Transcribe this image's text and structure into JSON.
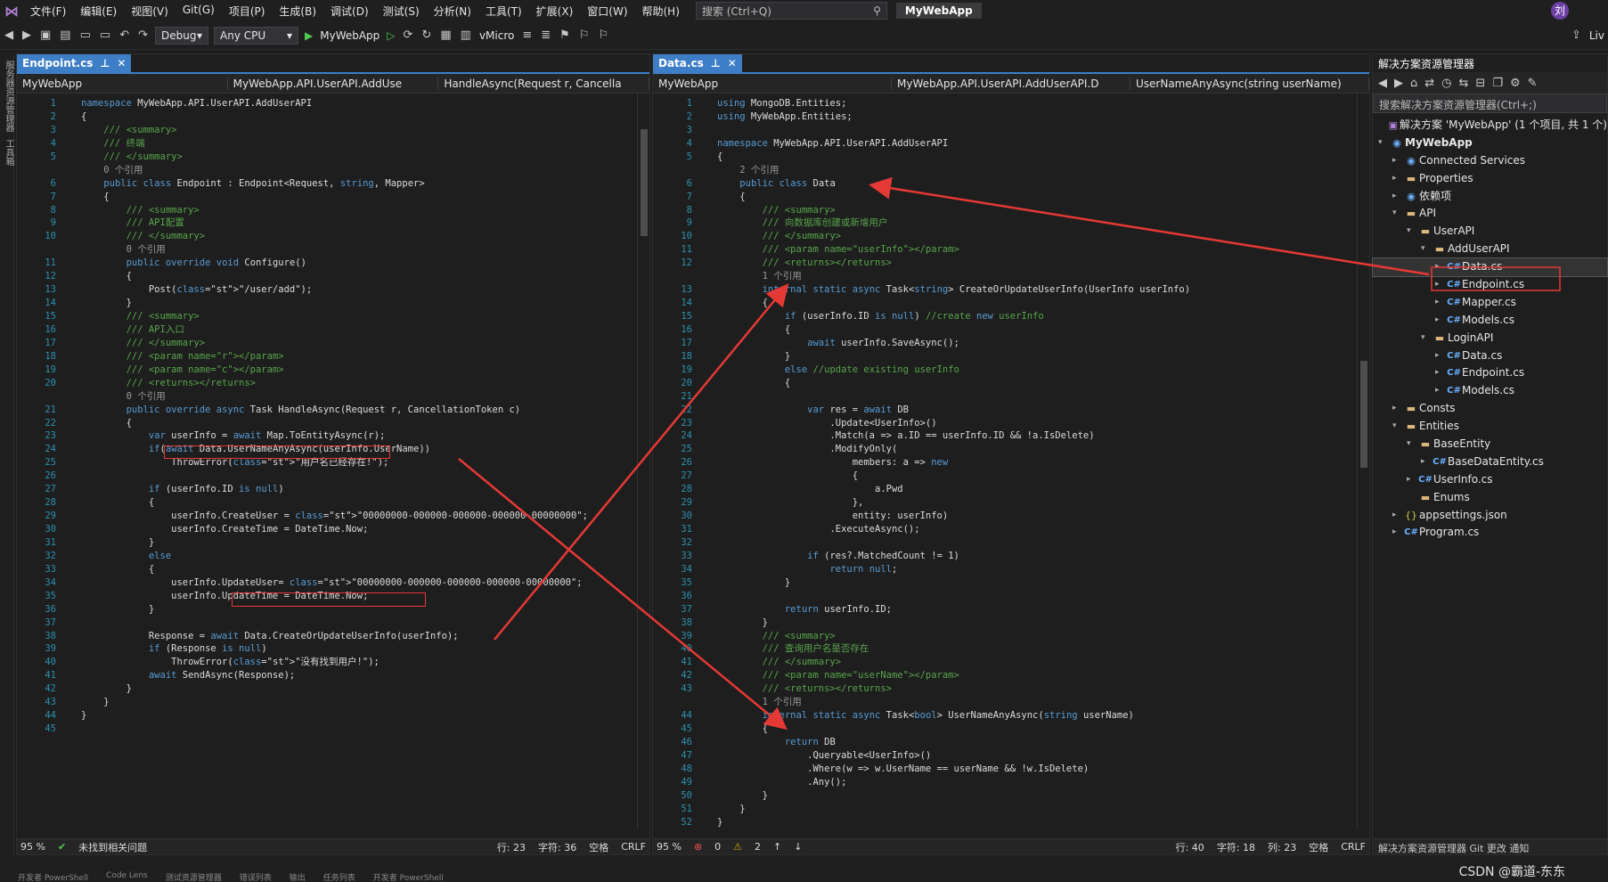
{
  "menubar": {
    "items": [
      "文件(F)",
      "编辑(E)",
      "视图(V)",
      "Git(G)",
      "项目(P)",
      "生成(B)",
      "调试(D)",
      "测试(S)",
      "分析(N)",
      "工具(T)",
      "扩展(X)",
      "窗口(W)",
      "帮助(H)"
    ],
    "search": "搜索 (Ctrl+Q)",
    "project": "MyWebApp",
    "avatar": "刘"
  },
  "toolbar": {
    "config": "Debug",
    "platform": "Any CPU",
    "run": "MyWebApp",
    "vmicro": "vMicro",
    "live": "Liv"
  },
  "leftstrip": {
    "a": "服务器资源管理器",
    "b": "工具箱"
  },
  "left": {
    "tab": "Endpoint.cs",
    "nav1": "MyWebApp",
    "nav2": "MyWebApp.API.UserAPI.AddUse",
    "nav3": "HandleAsync(Request r, Cancella",
    "lines": [
      "namespace MyWebApp.API.UserAPI.AddUserAPI",
      "{",
      "    /// <summary>",
      "    /// 终端",
      "    /// </summary>",
      "    0 个引用",
      "    public class Endpoint : Endpoint<Request, string, Mapper>",
      "    {",
      "        /// <summary>",
      "        /// API配置",
      "        /// </summary>",
      "        0 个引用",
      "        public override void Configure()",
      "        {",
      "            Post(\"/user/add\");",
      "        }",
      "        /// <summary>",
      "        /// API入口",
      "        /// </summary>",
      "        /// <param name=\"r\"></param>",
      "        /// <param name=\"c\"></param>",
      "        /// <returns></returns>",
      "        0 个引用",
      "        public override async Task HandleAsync(Request r, CancellationToken c)",
      "        {",
      "            var userInfo = await Map.ToEntityAsync(r);",
      "            if(await Data.UserNameAnyAsync(userInfo.UserName))",
      "                ThrowError(\"用户名已经存在!\");",
      "",
      "            if (userInfo.ID is null)",
      "            {",
      "                userInfo.CreateUser = \"00000000-000000-000000-000000-00000000\";",
      "                userInfo.CreateTime = DateTime.Now;",
      "            }",
      "            else",
      "            {",
      "                userInfo.UpdateUser= \"00000000-000000-000000-000000-00000000\";",
      "                userInfo.UpdateTime = DateTime.Now;",
      "            }",
      "",
      "            Response = await Data.CreateOrUpdateUserInfo(userInfo);",
      "            if (Response is null)",
      "                ThrowError(\"没有找到用户!\");",
      "            await SendAsync(Response);",
      "        }",
      "    }",
      "}",
      ""
    ],
    "nums": [
      "1",
      "2",
      "3",
      "4",
      "5",
      "",
      "6",
      "7",
      "8",
      "9",
      "10",
      "",
      "11",
      "12",
      "13",
      "14",
      "15",
      "16",
      "17",
      "18",
      "19",
      "20",
      "",
      "21",
      "22",
      "23",
      "24",
      "25",
      "26",
      "27",
      "28",
      "29",
      "30",
      "31",
      "32",
      "33",
      "34",
      "35",
      "36",
      "37",
      "38",
      "39",
      "40",
      "41",
      "42",
      "43",
      "44",
      "45"
    ],
    "status": {
      "zoom": "95 %",
      "issues": "未找到相关问题",
      "row": "行: 23",
      "col": "字符: 36",
      "space": "空格",
      "eol": "CRLF"
    }
  },
  "right": {
    "tab": "Data.cs",
    "nav1": "MyWebApp",
    "nav2": "MyWebApp.API.UserAPI.AddUserAPI.D",
    "nav3": "UserNameAnyAsync(string userName)",
    "lines": [
      "using MongoDB.Entities;",
      "using MyWebApp.Entities;",
      "",
      "namespace MyWebApp.API.UserAPI.AddUserAPI",
      "{",
      "    2 个引用",
      "    public class Data",
      "    {",
      "        /// <summary>",
      "        /// 向数据库创建或新增用户",
      "        /// </summary>",
      "        /// <param name=\"userInfo\"></param>",
      "        /// <returns></returns>",
      "        1 个引用",
      "        internal static async Task<string> CreateOrUpdateUserInfo(UserInfo userInfo)",
      "        {",
      "            if (userInfo.ID is null) //create new userInfo",
      "            {",
      "                await userInfo.SaveAsync();",
      "            }",
      "            else //update existing userInfo",
      "            {",
      "",
      "                var res = await DB",
      "                    .Update<UserInfo>()",
      "                    .Match(a => a.ID == userInfo.ID && !a.IsDelete)",
      "                    .ModifyOnly(",
      "                        members: a => new",
      "                        {",
      "                            a.Pwd",
      "                        },",
      "                        entity: userInfo)",
      "                    .ExecuteAsync();",
      "",
      "                if (res?.MatchedCount != 1)",
      "                    return null;",
      "            }",
      "",
      "            return userInfo.ID;",
      "        }",
      "        /// <summary>",
      "        /// 查询用户名是否存在",
      "        /// </summary>",
      "        /// <param name=\"userName\"></param>",
      "        /// <returns></returns>",
      "        1 个引用",
      "        internal static async Task<bool> UserNameAnyAsync(string userName)",
      "        {",
      "            return DB",
      "                .Queryable<UserInfo>()",
      "                .Where(w => w.UserName == userName && !w.IsDelete)",
      "                .Any();",
      "        }",
      "    }",
      "}"
    ],
    "nums": [
      "1",
      "2",
      "3",
      "4",
      "5",
      "",
      "6",
      "7",
      "8",
      "9",
      "10",
      "11",
      "12",
      "",
      "13",
      "14",
      "15",
      "16",
      "17",
      "18",
      "19",
      "20",
      "21",
      "22",
      "23",
      "24",
      "25",
      "26",
      "27",
      "28",
      "29",
      "30",
      "31",
      "32",
      "33",
      "34",
      "35",
      "36",
      "37",
      "38",
      "39",
      "40",
      "41",
      "42",
      "43",
      "",
      "44",
      "45",
      "46",
      "47",
      "48",
      "49",
      "50",
      "51",
      "52",
      "53"
    ],
    "status": {
      "zoom": "95 %",
      "errors": "0",
      "warnings": "2",
      "row": "行: 40",
      "col": "字符: 18",
      "colx": "列: 23",
      "space": "空格",
      "eol": "CRLF"
    }
  },
  "solution": {
    "title": "解决方案资源管理器",
    "search": "搜索解决方案资源管理器(Ctrl+;)",
    "bottom": "解决方案资源管理器",
    "tabs2": "Git 更改",
    "tabs3": "通知",
    "items": [
      {
        "t": "解决方案 'MyWebApp' (1 个项目, 共 1 个)",
        "d": 0,
        "ic": "sln",
        "ar": ""
      },
      {
        "t": "MyWebApp",
        "d": 0,
        "ic": "proj",
        "ar": "▾",
        "b": 1
      },
      {
        "t": "Connected Services",
        "d": 1,
        "ic": "proj",
        "ar": "▸"
      },
      {
        "t": "Properties",
        "d": 1,
        "ic": "folder",
        "ar": "▸"
      },
      {
        "t": "依赖项",
        "d": 1,
        "ic": "proj",
        "ar": "▸"
      },
      {
        "t": "API",
        "d": 1,
        "ic": "folder",
        "ar": "▾"
      },
      {
        "t": "UserAPI",
        "d": 2,
        "ic": "folder",
        "ar": "▾"
      },
      {
        "t": "AddUserAPI",
        "d": 3,
        "ic": "folder",
        "ar": "▾"
      },
      {
        "t": "Data.cs",
        "d": 4,
        "ic": "cs",
        "ar": "▸",
        "sel": 1
      },
      {
        "t": "Endpoint.cs",
        "d": 4,
        "ic": "cs",
        "ar": "▸"
      },
      {
        "t": "Mapper.cs",
        "d": 4,
        "ic": "cs",
        "ar": "▸"
      },
      {
        "t": "Models.cs",
        "d": 4,
        "ic": "cs",
        "ar": "▸"
      },
      {
        "t": "LoginAPI",
        "d": 3,
        "ic": "folder",
        "ar": "▾"
      },
      {
        "t": "Data.cs",
        "d": 4,
        "ic": "cs",
        "ar": "▸"
      },
      {
        "t": "Endpoint.cs",
        "d": 4,
        "ic": "cs",
        "ar": "▸"
      },
      {
        "t": "Models.cs",
        "d": 4,
        "ic": "cs",
        "ar": "▸"
      },
      {
        "t": "Consts",
        "d": 1,
        "ic": "folder",
        "ar": "▸"
      },
      {
        "t": "Entities",
        "d": 1,
        "ic": "folder",
        "ar": "▾"
      },
      {
        "t": "BaseEntity",
        "d": 2,
        "ic": "folder",
        "ar": "▾"
      },
      {
        "t": "BaseDataEntity.cs",
        "d": 3,
        "ic": "cs",
        "ar": "▸"
      },
      {
        "t": "UserInfo.cs",
        "d": 2,
        "ic": "cs",
        "ar": "▸"
      },
      {
        "t": "Enums",
        "d": 2,
        "ic": "folder",
        "ar": ""
      },
      {
        "t": "appsettings.json",
        "d": 1,
        "ic": "json",
        "ar": "▸"
      },
      {
        "t": "Program.cs",
        "d": 1,
        "ic": "cs",
        "ar": "▸"
      }
    ]
  },
  "watermark": "CSDN @霸道-东东",
  "bottomtabs": [
    "开发者 PowerShell",
    "Code Lens",
    "测试资源管理器",
    "错误列表",
    "输出",
    "任务列表",
    "开发者 PowerShell"
  ]
}
